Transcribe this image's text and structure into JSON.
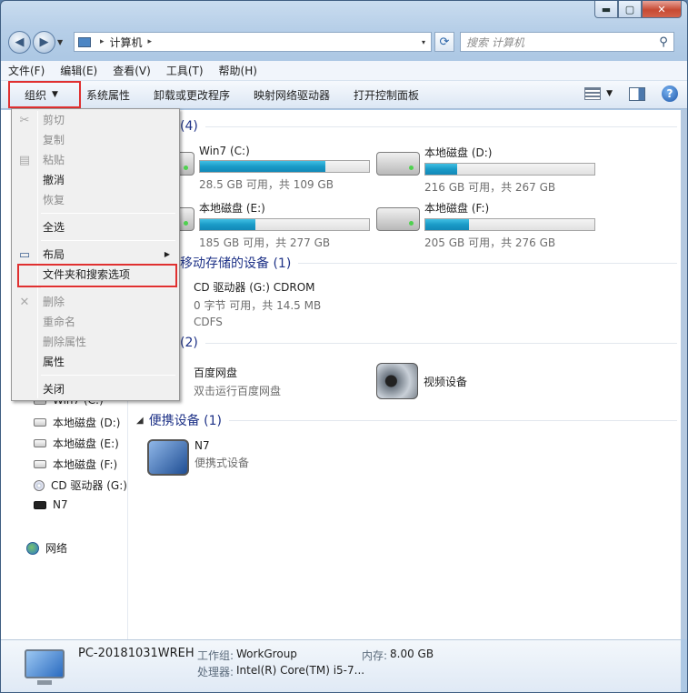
{
  "window": {
    "caption": {
      "minimize": "▬",
      "maximize": "▢",
      "close": "✕"
    }
  },
  "address": {
    "crumb": "计算机",
    "sep": "▸",
    "drop": "▾"
  },
  "search": {
    "placeholder": "搜索 计算机",
    "icon": "search-icon"
  },
  "menubar": [
    "文件(F)",
    "编辑(E)",
    "查看(V)",
    "工具(T)",
    "帮助(H)"
  ],
  "cmdbar": {
    "organize": "组织",
    "items": [
      "系统属性",
      "卸载或更改程序",
      "映射网络驱动器",
      "打开控制面板"
    ]
  },
  "org_menu": {
    "cut": "剪切",
    "copy": "复制",
    "paste": "粘贴",
    "undo": "撤消",
    "redo": "恢复",
    "select_all": "全选",
    "layout": "布局",
    "folder_options": "文件夹和搜索选项",
    "delete": "删除",
    "rename": "重命名",
    "remove_props": "删除属性",
    "properties": "属性",
    "close": "关闭"
  },
  "navpane": {
    "items": [
      "Win7 (C:)",
      "本地磁盘 (D:)",
      "本地磁盘 (E:)",
      "本地磁盘 (F:)",
      "CD 驱动器 (G:)",
      "N7",
      "网络"
    ]
  },
  "groups": {
    "hdd_header": "(4)",
    "removable_header": "移动存储的设备 (1)",
    "other_header": "(2)",
    "portable_header": "便携设备 (1)"
  },
  "drives": [
    {
      "name": "Win7 (C:)",
      "free": "28.5 GB 可用，共 109 GB",
      "used": 0.74
    },
    {
      "name": "本地磁盘 (D:)",
      "free": "216 GB 可用，共 267 GB",
      "used": 0.19
    },
    {
      "name": "本地磁盘 (E:)",
      "free": "185 GB 可用，共 277 GB",
      "used": 0.33
    },
    {
      "name": "本地磁盘 (F:)",
      "free": "205 GB 可用，共 276 GB",
      "used": 0.26
    }
  ],
  "cdrom": {
    "name": "CD 驱动器 (G:) CDROM",
    "free": "0 字节 可用，共 14.5 MB",
    "fs": "CDFS"
  },
  "baidu": {
    "name": "百度网盘",
    "sub": "双击运行百度网盘"
  },
  "video": {
    "name": "视频设备"
  },
  "n7": {
    "name": "N7",
    "sub": "便携式设备"
  },
  "details": {
    "pc_name": "PC-20181031WREH",
    "workgroup_label": "工作组:",
    "workgroup": "WorkGroup",
    "memory_label": "内存:",
    "memory": "8.00 GB",
    "cpu_label": "处理器:",
    "cpu": "Intel(R) Core(TM) i5-7..."
  }
}
